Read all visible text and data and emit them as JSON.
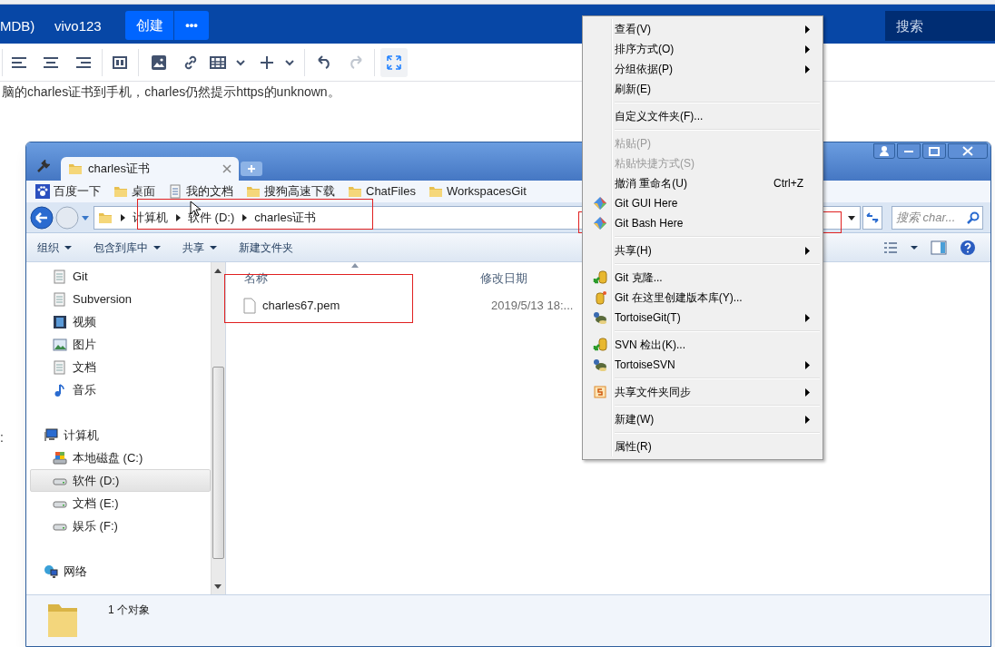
{
  "header": {
    "crumbs": [
      "MDB)",
      "vivo123"
    ],
    "create_button": "创建",
    "more_button": "•••",
    "search": {
      "placeholder": "搜索"
    }
  },
  "editor_toolbar": {
    "history": [
      {
        "disabled": false
      },
      {
        "disabled": true
      }
    ],
    "fullscreen": {
      "active": true
    }
  },
  "page_text": [
    "脑的charles证书到手机，charles仍然提示https的unknown。",
    ":"
  ],
  "explorer": {
    "tab": {
      "title": "charles证书"
    },
    "bookmarks": [
      "百度一下",
      "桌面",
      "我的文档",
      "搜狗高速下载",
      "ChatFiles",
      "WorkspacesGit"
    ],
    "breadcrumb": [
      "计算机",
      "软件 (D:)",
      "charles证书"
    ],
    "search": {
      "placeholder": "搜索 char..."
    },
    "commands": [
      {
        "label": "组织",
        "dropdown": true
      },
      {
        "label": "包含到库中",
        "dropdown": true
      },
      {
        "label": "共享",
        "dropdown": true
      },
      {
        "label": "新建文件夹",
        "dropdown": false
      }
    ],
    "nav": [
      {
        "label": "Git",
        "kind": "library",
        "selected": false
      },
      {
        "label": "Subversion",
        "kind": "library",
        "selected": false
      },
      {
        "label": "视频",
        "kind": "video",
        "selected": false
      },
      {
        "label": "图片",
        "kind": "pictures",
        "selected": false
      },
      {
        "label": "文档",
        "kind": "library",
        "selected": false
      },
      {
        "label": "音乐",
        "kind": "music",
        "selected": false
      },
      {
        "label": "计算机",
        "kind": "computer",
        "selected": false,
        "children": [
          {
            "label": "本地磁盘 (C:)",
            "kind": "system-drive",
            "selected": false
          },
          {
            "label": "软件 (D:)",
            "kind": "drive",
            "selected": true
          },
          {
            "label": "文档 (E:)",
            "kind": "drive",
            "selected": false
          },
          {
            "label": "娱乐 (F:)",
            "kind": "drive",
            "selected": false
          }
        ]
      },
      {
        "label": "网络",
        "kind": "network",
        "selected": false
      }
    ],
    "columns": [
      "名称",
      "修改日期"
    ],
    "files": [
      {
        "name": "charles67.pem",
        "modified": "2019/5/13 18:..."
      }
    ],
    "status": "1 个对象"
  },
  "context_menu": [
    {
      "kind": "item",
      "label": "查看(V)",
      "disabled": false,
      "submenu": true
    },
    {
      "kind": "item",
      "label": "排序方式(O)",
      "disabled": false,
      "submenu": true
    },
    {
      "kind": "item",
      "label": "分组依据(P)",
      "disabled": false,
      "submenu": true
    },
    {
      "kind": "item",
      "label": "刷新(E)",
      "disabled": false,
      "submenu": false
    },
    {
      "kind": "separator"
    },
    {
      "kind": "item",
      "label": "自定义文件夹(F)...",
      "disabled": false,
      "submenu": false
    },
    {
      "kind": "separator"
    },
    {
      "kind": "item",
      "label": "粘贴(P)",
      "disabled": true,
      "submenu": false
    },
    {
      "kind": "item",
      "label": "粘贴快捷方式(S)",
      "disabled": true,
      "submenu": false
    },
    {
      "kind": "item",
      "label": "撤消 重命名(U)",
      "disabled": false,
      "submenu": false,
      "shortcut": "Ctrl+Z"
    },
    {
      "kind": "item",
      "label": "Git GUI Here",
      "disabled": false,
      "submenu": false
    },
    {
      "kind": "item",
      "label": "Git Bash Here",
      "disabled": false,
      "submenu": false
    },
    {
      "kind": "separator"
    },
    {
      "kind": "item",
      "label": "共享(H)",
      "disabled": false,
      "submenu": true
    },
    {
      "kind": "separator"
    },
    {
      "kind": "item",
      "label": "Git 克隆...",
      "disabled": false,
      "submenu": false
    },
    {
      "kind": "item",
      "label": "Git 在这里创建版本库(Y)...",
      "disabled": false,
      "submenu": false
    },
    {
      "kind": "item",
      "label": "TortoiseGit(T)",
      "disabled": false,
      "submenu": true
    },
    {
      "kind": "separator"
    },
    {
      "kind": "item",
      "label": "SVN 检出(K)...",
      "disabled": false,
      "submenu": false
    },
    {
      "kind": "item",
      "label": "TortoiseSVN",
      "disabled": false,
      "submenu": true
    },
    {
      "kind": "separator"
    },
    {
      "kind": "item",
      "label": "共享文件夹同步",
      "disabled": false,
      "submenu": true
    },
    {
      "kind": "separator"
    },
    {
      "kind": "item",
      "label": "新建(W)",
      "disabled": false,
      "submenu": true
    },
    {
      "kind": "separator"
    },
    {
      "kind": "item",
      "label": "属性(R)",
      "disabled": false,
      "submenu": false
    }
  ]
}
